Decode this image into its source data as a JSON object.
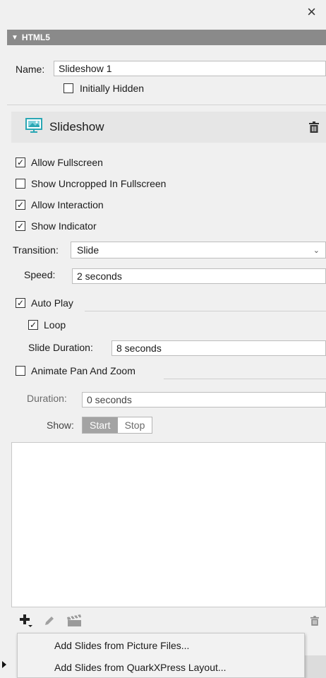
{
  "window": {
    "close_glyph": "×"
  },
  "panel": {
    "title": "HTML5"
  },
  "name_field": {
    "label": "Name:",
    "value": "Slideshow 1"
  },
  "initially_hidden": {
    "label": "Initially Hidden",
    "checked": false
  },
  "slideshow": {
    "title": "Slideshow",
    "icon": "slideshow-icon"
  },
  "options": [
    {
      "label": "Allow Fullscreen",
      "checked": true
    },
    {
      "label": "Show Uncropped In Fullscreen",
      "checked": false
    },
    {
      "label": "Allow Interaction",
      "checked": true
    },
    {
      "label": "Show Indicator",
      "checked": true
    }
  ],
  "transition": {
    "label": "Transition:",
    "value": "Slide"
  },
  "speed": {
    "label": "Speed:",
    "value": "2 seconds"
  },
  "auto_play": {
    "label": "Auto Play",
    "checked": true
  },
  "loop": {
    "label": "Loop",
    "checked": true
  },
  "slide_duration": {
    "label": "Slide Duration:",
    "value": "8 seconds"
  },
  "animate": {
    "label": "Animate Pan And Zoom",
    "checked": false
  },
  "duration": {
    "label": "Duration:",
    "value": "0 seconds"
  },
  "show": {
    "label": "Show:",
    "options": [
      "Start",
      "Stop"
    ],
    "selected": "Start"
  },
  "menu": {
    "items": [
      "Add Slides from Picture Files...",
      "Add Slides from QuarkXPress Layout..."
    ]
  },
  "colors": {
    "header": "#8a8a8a",
    "panel": "#f0f0f0",
    "section": "#e6e6e6",
    "accent": "#2aa7b4"
  }
}
